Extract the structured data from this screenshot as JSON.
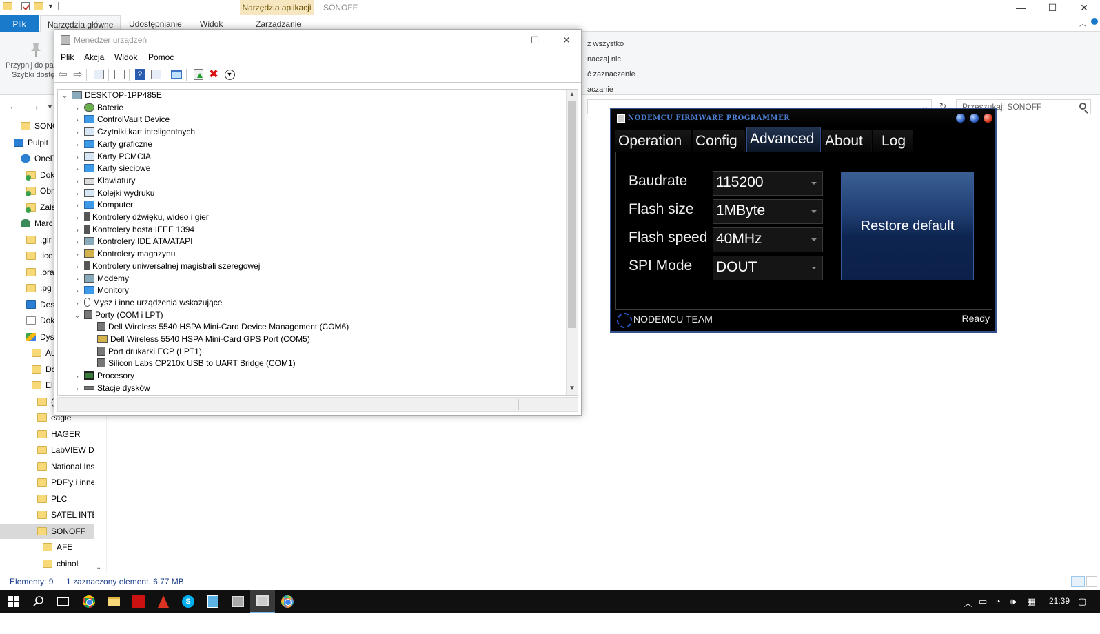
{
  "explorer": {
    "context_tab_header": "Narzędzia aplikacji",
    "window_title": "SONOFF",
    "window_controls": {
      "minimize": "—",
      "maximize": "☐",
      "close": "✕"
    },
    "ribbon_tabs": {
      "file": "Plik",
      "home": "Narzędzia główne",
      "share": "Udostępnianie",
      "view": "Widok",
      "manage": "Zarządzanie"
    },
    "ribbon": {
      "pin_label_line1": "Przypnij do pa",
      "pin_label_line2": "Szybki dostę",
      "select_all": "ź wszystko",
      "select_none": "naczaj nic",
      "invert_selection": "ć zaznaczenie",
      "select_group": "aczanie"
    },
    "search_placeholder": "Przeszukaj: SONOFF",
    "nav_items": [
      {
        "label": "SONO",
        "icon": "folder"
      },
      {
        "label": "Pulpit",
        "icon": "desktop"
      },
      {
        "label": "OneD",
        "icon": "cloud"
      },
      {
        "label": "Dok",
        "icon": "green"
      },
      {
        "label": "Obr",
        "icon": "green"
      },
      {
        "label": "Załą",
        "icon": "green"
      },
      {
        "label": "Marc",
        "icon": "person"
      },
      {
        "label": ".gir",
        "icon": "folder"
      },
      {
        "label": ".ice",
        "icon": "folder"
      },
      {
        "label": ".ora",
        "icon": "folder"
      },
      {
        "label": ".pg",
        "icon": "folder"
      },
      {
        "label": "Des",
        "icon": "desktop"
      },
      {
        "label": "Dok",
        "icon": "doc"
      },
      {
        "label": "Dys",
        "icon": "drive"
      },
      {
        "label": "Au",
        "icon": "folder"
      },
      {
        "label": "Do",
        "icon": "folder"
      },
      {
        "label": "El",
        "icon": "folder"
      },
      {
        "label": "(",
        "icon": "folder"
      },
      {
        "label": "eagle",
        "icon": "folder"
      },
      {
        "label": "HAGER",
        "icon": "folder"
      },
      {
        "label": "LabVIEW Da",
        "icon": "folder"
      },
      {
        "label": "National Ins",
        "icon": "folder"
      },
      {
        "label": "PDF'y i inne",
        "icon": "folder"
      },
      {
        "label": "PLC",
        "icon": "folder"
      },
      {
        "label": "SATEL INTE(",
        "icon": "folder"
      },
      {
        "label": "SONOFF",
        "icon": "folder",
        "selected": true
      },
      {
        "label": "AFE",
        "icon": "folder"
      },
      {
        "label": "chinol",
        "icon": "folder"
      }
    ],
    "status": {
      "items_count": "Elementy: 9",
      "selection": "1 zaznaczony element. 6,77 MB"
    }
  },
  "device_manager": {
    "title": "Menedżer urządzeń",
    "window_controls": {
      "minimize": "—",
      "maximize": "☐",
      "close": "✕"
    },
    "menu": {
      "file": "Plik",
      "action": "Akcja",
      "view": "Widok",
      "help": "Pomoc"
    },
    "root": "DESKTOP-1PP485E",
    "categories": [
      {
        "label": "Baterie",
        "icon": "green"
      },
      {
        "label": "ControlVault Device",
        "icon": "mon"
      },
      {
        "label": "Czytniki kart inteligentnych",
        "icon": "default"
      },
      {
        "label": "Karty graficzne",
        "icon": "mon"
      },
      {
        "label": "Karty PCMCIA",
        "icon": "default"
      },
      {
        "label": "Karty sieciowe",
        "icon": "mon"
      },
      {
        "label": "Klawiatury",
        "icon": "kbd"
      },
      {
        "label": "Kolejki wydruku",
        "icon": "default"
      },
      {
        "label": "Komputer",
        "icon": "mon"
      },
      {
        "label": "Kontrolery dźwięku, wideo i gier",
        "icon": "usb"
      },
      {
        "label": "Kontrolery hosta IEEE 1394",
        "icon": "usb"
      },
      {
        "label": "Kontrolery IDE ATA/ATAPI",
        "icon": "pc"
      },
      {
        "label": "Kontrolery magazynu",
        "icon": "gold"
      },
      {
        "label": "Kontrolery uniwersalnej magistrali szeregowej",
        "icon": "usb"
      },
      {
        "label": "Modemy",
        "icon": "pc"
      },
      {
        "label": "Monitory",
        "icon": "mon"
      },
      {
        "label": "Mysz i inne urządzenia wskazujące",
        "icon": "mouse"
      },
      {
        "label": "Porty (COM i LPT)",
        "icon": "port",
        "expanded": true
      }
    ],
    "ports": [
      {
        "label": "Dell Wireless 5540 HSPA Mini-Card Device Management (COM6)",
        "icon": "port"
      },
      {
        "label": "Dell Wireless 5540 HSPA Mini-Card GPS Port (COM5)",
        "icon": "gold"
      },
      {
        "label": "Port drukarki ECP (LPT1)",
        "icon": "port"
      },
      {
        "label": "Silicon Labs CP210x USB to UART Bridge (COM1)",
        "icon": "port"
      }
    ],
    "after": [
      {
        "label": "Procesory",
        "icon": "chip"
      },
      {
        "label": "Stacje dysków",
        "icon": "disk"
      }
    ]
  },
  "nodemcu": {
    "title": "NODEMCU FIRMWARE PROGRAMMER",
    "tabs": {
      "operation": "Operation",
      "config": "Config",
      "advanced": "Advanced",
      "about": "About",
      "log": "Log"
    },
    "fields": {
      "baudrate": {
        "label": "Baudrate",
        "value": "115200"
      },
      "flash_size": {
        "label": "Flash size",
        "value": "1MByte"
      },
      "flash_speed": {
        "label": "Flash speed",
        "value": "40MHz"
      },
      "spi_mode": {
        "label": "SPI Mode",
        "value": "DOUT"
      }
    },
    "restore_button": "Restore default",
    "footer_team": "NODEMCU TEAM",
    "footer_status": "Ready"
  },
  "taskbar": {
    "clock": "21:39"
  }
}
